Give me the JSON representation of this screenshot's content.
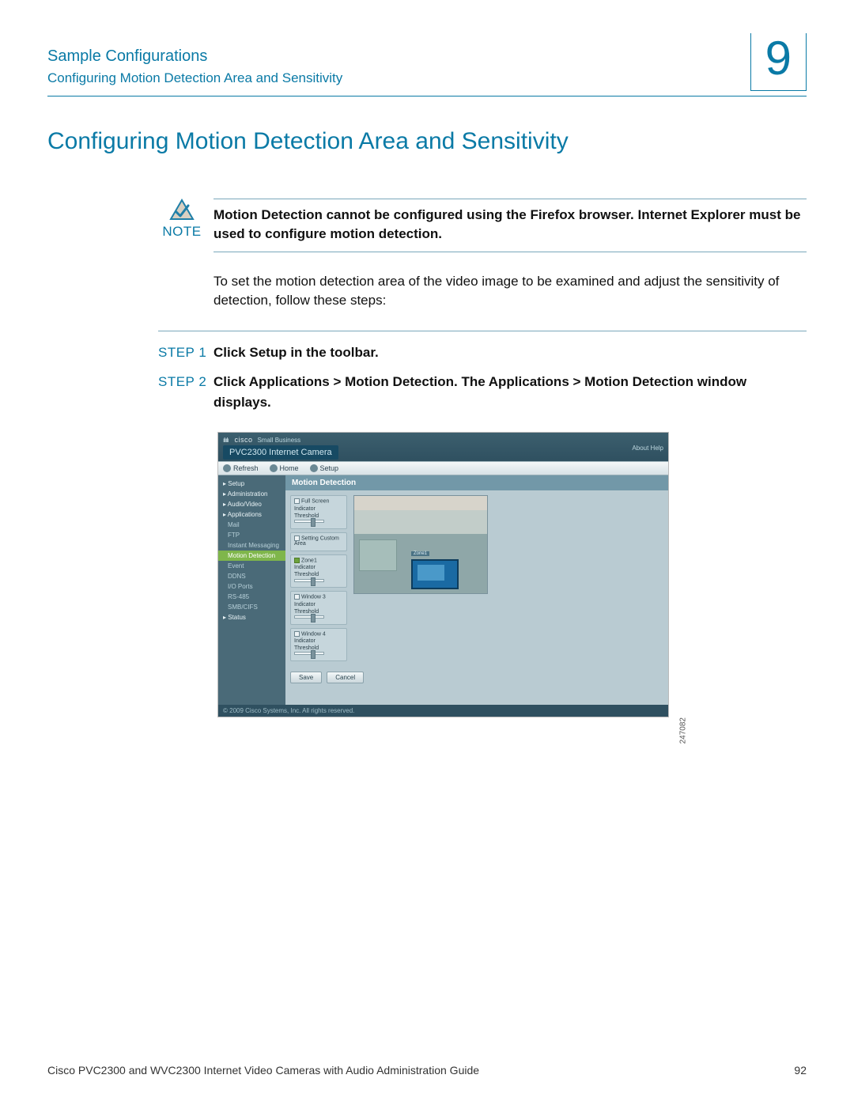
{
  "header": {
    "chapter_title": "Sample Configurations",
    "section_sub": "Configuring Motion Detection Area and Sensitivity",
    "chapter_num": "9"
  },
  "main_title": "Configuring Motion Detection Area and Sensitivity",
  "note": {
    "label": "NOTE",
    "text": "Motion Detection cannot be configured using the Firefox browser. Internet Explorer must be used to configure motion detection."
  },
  "intro": "To set the motion detection area of the video image to be examined and adjust the sensitivity of detection, follow these steps:",
  "steps": {
    "s1": {
      "label": "STEP 1",
      "pre": "Click ",
      "cmd": "Setup",
      "post": " in the toolbar."
    },
    "s2": {
      "label": "STEP 2",
      "pre": "Click ",
      "cmd": "Applications > Motion Detection",
      "post1": ". The Applications > Motion Detection window displays."
    }
  },
  "screenshot": {
    "id": "247082",
    "brand_small": "Small Business",
    "brand": "cisco",
    "model": "PVC2300 Internet Camera",
    "top_links": "About   Help",
    "toolbar": {
      "refresh": "Refresh",
      "home": "Home",
      "setup": "Setup"
    },
    "sidebar": [
      {
        "label": "▸ Setup",
        "cls": "head"
      },
      {
        "label": "▸ Administration",
        "cls": "head"
      },
      {
        "label": "▸ Audio/Video",
        "cls": "head"
      },
      {
        "label": "▸ Applications",
        "cls": "head"
      },
      {
        "label": "Mail",
        "cls": "sub"
      },
      {
        "label": "FTP",
        "cls": "sub"
      },
      {
        "label": "Instant Messaging",
        "cls": "sub"
      },
      {
        "label": "Motion Detection",
        "cls": "sub active"
      },
      {
        "label": "Event",
        "cls": "sub"
      },
      {
        "label": "DDNS",
        "cls": "sub"
      },
      {
        "label": "I/O Ports",
        "cls": "sub"
      },
      {
        "label": "RS-485",
        "cls": "sub"
      },
      {
        "label": "SMB/CIFS",
        "cls": "sub"
      },
      {
        "label": "▸ Status",
        "cls": "head"
      }
    ],
    "panel_title": "Motion Detection",
    "groups": {
      "g1": {
        "chk": "Full Screen",
        "ind": "Indicator",
        "thr": "Threshold"
      },
      "g2": {
        "chk": "Setting Custom Area"
      },
      "g3": {
        "chk": "Zone1",
        "ind": "Indicator",
        "thr": "Threshold"
      },
      "g4": {
        "chk": "Window 3",
        "ind": "Indicator",
        "thr": "Threshold"
      },
      "g5": {
        "chk": "Window 4",
        "ind": "Indicator",
        "thr": "Threshold"
      }
    },
    "overlay_label": "Zone1",
    "buttons": {
      "save": "Save",
      "cancel": "Cancel"
    },
    "copyright": "© 2009 Cisco Systems, Inc. All rights reserved."
  },
  "footer": {
    "doc": "Cisco PVC2300 and WVC2300 Internet Video Cameras with Audio Administration Guide",
    "page": "92"
  }
}
